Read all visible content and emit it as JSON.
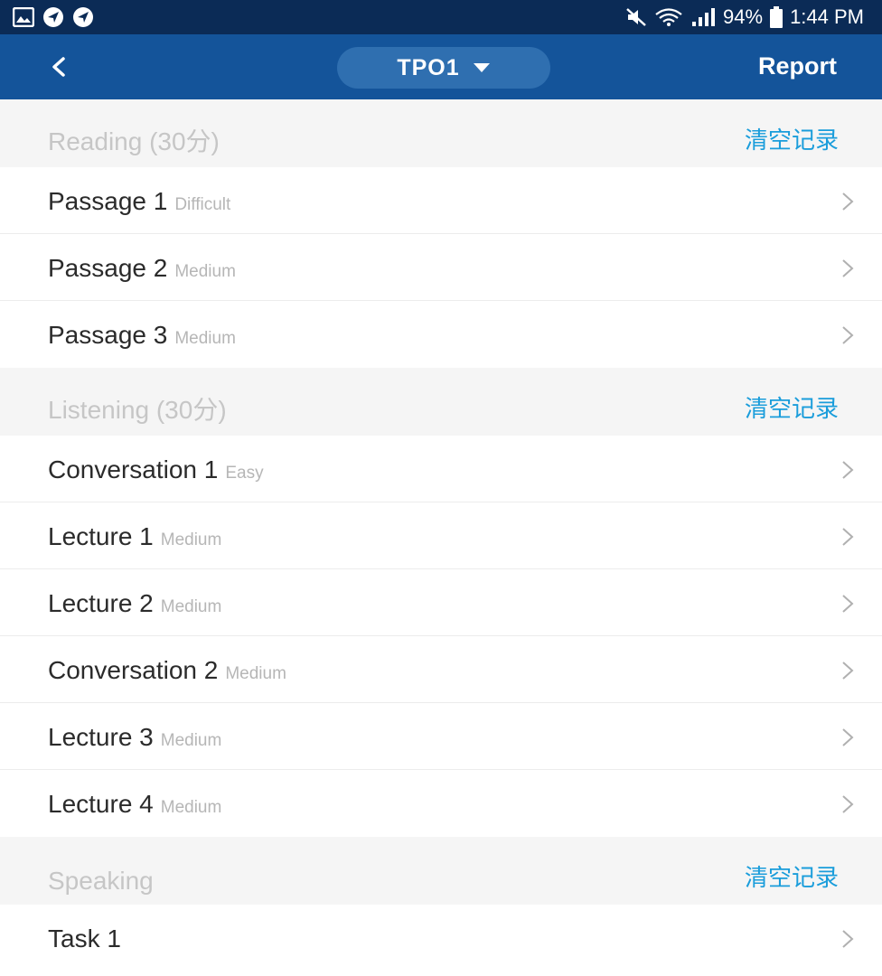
{
  "status_bar": {
    "left_icons": [
      "image-icon",
      "navigation-icon",
      "navigation-icon"
    ],
    "battery": "94%",
    "time": "1:44 PM"
  },
  "header": {
    "title": "TPO1",
    "report_label": "Report"
  },
  "sections": [
    {
      "title": "Reading (30分)",
      "clear_label": "清空记录",
      "items": [
        {
          "label": "Passage 1",
          "difficulty": "Difficult"
        },
        {
          "label": "Passage 2",
          "difficulty": "Medium"
        },
        {
          "label": "Passage 3",
          "difficulty": "Medium"
        }
      ]
    },
    {
      "title": "Listening (30分)",
      "clear_label": "清空记录",
      "items": [
        {
          "label": "Conversation 1",
          "difficulty": "Easy"
        },
        {
          "label": "Lecture 1",
          "difficulty": "Medium"
        },
        {
          "label": "Lecture 2",
          "difficulty": "Medium"
        },
        {
          "label": "Conversation 2",
          "difficulty": "Medium"
        },
        {
          "label": "Lecture 3",
          "difficulty": "Medium"
        },
        {
          "label": "Lecture 4",
          "difficulty": "Medium"
        }
      ]
    },
    {
      "title": "Speaking",
      "clear_label": "清空记录",
      "items": [
        {
          "label": "Task 1",
          "difficulty": ""
        }
      ]
    }
  ]
}
